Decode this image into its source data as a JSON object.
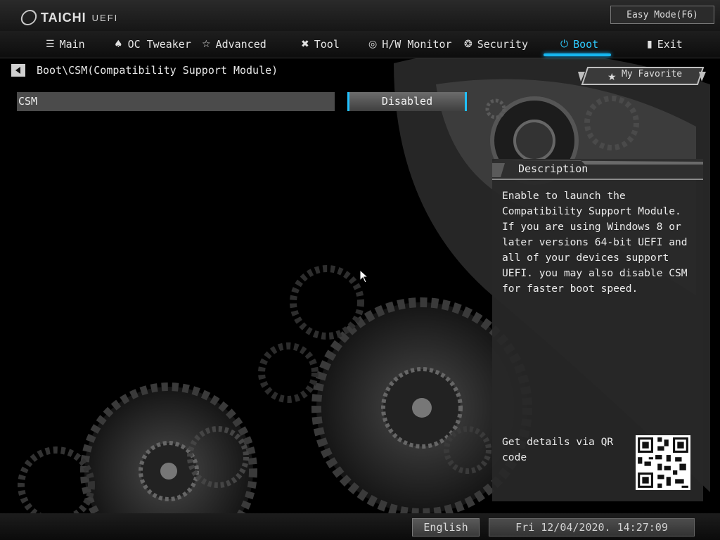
{
  "brand": {
    "name": "TAICHI",
    "suffix": "UEFI"
  },
  "easy_mode": {
    "label": "Easy Mode(F6)"
  },
  "nav": {
    "tabs": [
      {
        "label": "Main",
        "icon": "list-icon"
      },
      {
        "label": "OC Tweaker",
        "icon": "rocket-icon"
      },
      {
        "label": "Advanced",
        "icon": "star-icon"
      },
      {
        "label": "Tool",
        "icon": "tools-icon"
      },
      {
        "label": "H/W Monitor",
        "icon": "monitor-icon"
      },
      {
        "label": "Security",
        "icon": "shield-icon"
      },
      {
        "label": "Boot",
        "icon": "power-icon",
        "active": true
      },
      {
        "label": "Exit",
        "icon": "exit-icon"
      }
    ],
    "active_color": "#16b6f0"
  },
  "breadcrumb": {
    "path": "Boot\\CSM(Compatibility Support Module)"
  },
  "favorite": {
    "label": "My Favorite"
  },
  "settings": [
    {
      "label": "CSM",
      "value": "Disabled"
    }
  ],
  "description": {
    "title": "Description",
    "text": "Enable to launch the Compatibility Support Module. If you are using Windows 8 or later versions 64-bit UEFI and all of your devices support UEFI. you may also disable CSM for faster boot speed.",
    "qr_caption": "Get details via QR code"
  },
  "footer": {
    "language": "English",
    "datetime": "Fri 12/04/2020. 14:27:09"
  }
}
